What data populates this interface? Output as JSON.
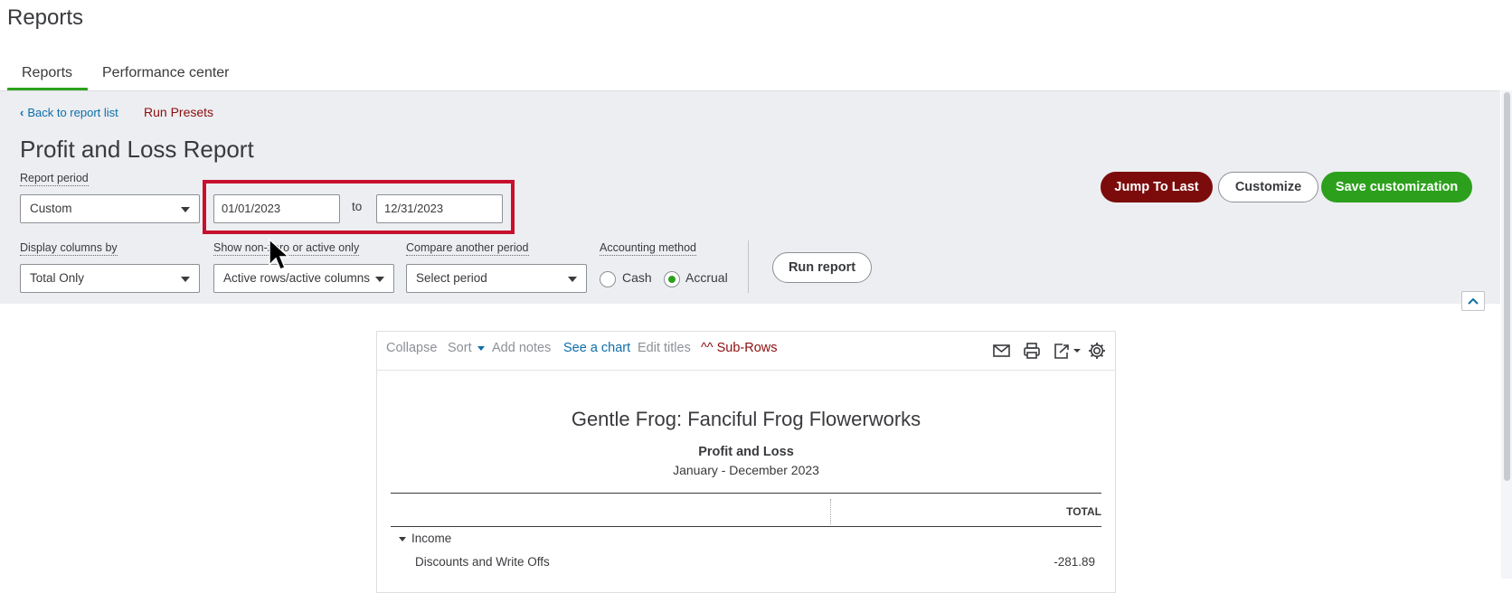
{
  "page": {
    "title": "Reports"
  },
  "tabs": [
    {
      "label": "Reports",
      "active": true
    },
    {
      "label": "Performance center",
      "active": false
    }
  ],
  "nav": {
    "back_label": "Back to report list",
    "presets_label": "Run Presets"
  },
  "report_header": {
    "title": "Profit and Loss Report",
    "period_label": "Report period",
    "period_value": "Custom",
    "date_from": "01/01/2023",
    "to_label": "to",
    "date_to": "12/31/2023"
  },
  "actions": {
    "jump_label": "Jump To Last",
    "customize_label": "Customize",
    "save_label": "Save customization",
    "run_label": "Run report"
  },
  "filters": {
    "display_label": "Display columns by",
    "display_value": "Total Only",
    "nonzero_label": "Show non-zero or active only",
    "nonzero_value": "Active rows/active columns",
    "compare_label": "Compare another period",
    "compare_value": "Select period",
    "method_label": "Accounting method",
    "method_cash": "Cash",
    "method_accrual": "Accrual",
    "method_selected": "Accrual"
  },
  "toolbar": {
    "collapse": "Collapse",
    "sort": "Sort",
    "add_notes": "Add notes",
    "see_chart": "See a chart",
    "edit_titles": "Edit titles",
    "sub_rows": "^^ Sub-Rows"
  },
  "report": {
    "company": "Gentle Frog: Fanciful Frog Flowerworks",
    "name": "Profit and Loss",
    "period": "January - December 2023",
    "total_header": "TOTAL",
    "rows": [
      {
        "label": "Income",
        "value": ""
      },
      {
        "label": "Discounts and Write Offs",
        "value": "-281.89"
      }
    ]
  },
  "colors": {
    "brand_green": "#2ca01c",
    "jump_red": "#7c0c0c",
    "highlight": "#c8102e",
    "link_blue": "#0d6ea7"
  }
}
